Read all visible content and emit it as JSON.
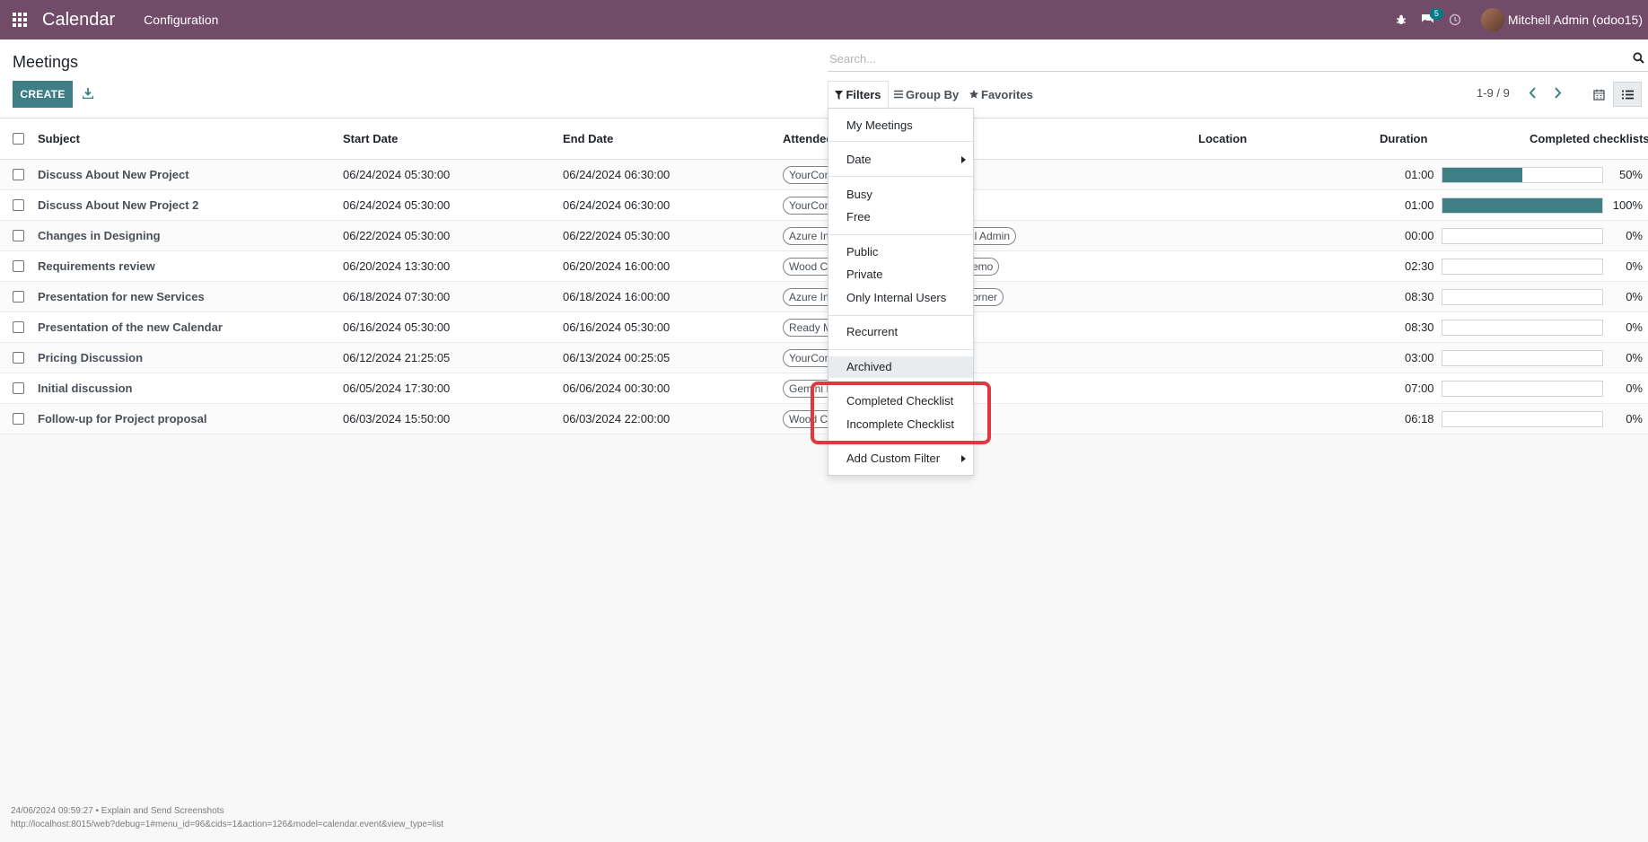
{
  "navbar": {
    "app_title": "Calendar",
    "menu_configuration": "Configuration",
    "messages_count": "5",
    "user_name": "Mitchell Admin (odoo15)"
  },
  "control_panel": {
    "page_title": "Meetings",
    "create_label": "CREATE",
    "search_placeholder": "Search...",
    "filters_label": "Filters",
    "group_by_label": "Group By",
    "favorites_label": "Favorites",
    "pager_value": "1-9 / 9"
  },
  "table": {
    "headers": {
      "subject": "Subject",
      "start_date": "Start Date",
      "end_date": "End Date",
      "attendees": "Attendee",
      "location": "Location",
      "duration": "Duration",
      "completed_checklists": "Completed checklists"
    },
    "rows": [
      {
        "subject": "Discuss About New Project",
        "start": "06/24/2024 05:30:00",
        "end": "06/24/2024 06:30:00",
        "tag1": "YourCom",
        "tag2": "",
        "duration": "01:00",
        "progress": 50,
        "progress_label": "50%"
      },
      {
        "subject": "Discuss About New Project 2",
        "start": "06/24/2024 05:30:00",
        "end": "06/24/2024 06:30:00",
        "tag1": "YourCom",
        "tag2": "",
        "duration": "01:00",
        "progress": 100,
        "progress_label": "100%"
      },
      {
        "subject": "Changes in Designing",
        "start": "06/22/2024 05:30:00",
        "end": "06/22/2024 05:30:00",
        "tag1": "Azure In",
        "tag2": "ll Admin",
        "duration": "00:00",
        "progress": 0,
        "progress_label": "0%"
      },
      {
        "subject": "Requirements review",
        "start": "06/20/2024 13:30:00",
        "end": "06/20/2024 16:00:00",
        "tag1": "Wood Co",
        "tag2": "emo",
        "duration": "02:30",
        "progress": 0,
        "progress_label": "0%"
      },
      {
        "subject": "Presentation for new Services",
        "start": "06/18/2024 07:30:00",
        "end": "06/18/2024 16:00:00",
        "tag1": "Azure In",
        "tag2": "orner",
        "duration": "08:30",
        "progress": 0,
        "progress_label": "0%"
      },
      {
        "subject": "Presentation of the new Calendar",
        "start": "06/16/2024 05:30:00",
        "end": "06/16/2024 05:30:00",
        "tag1": "Ready M",
        "tag2": "",
        "duration": "08:30",
        "progress": 0,
        "progress_label": "0%"
      },
      {
        "subject": "Pricing Discussion",
        "start": "06/12/2024 21:25:05",
        "end": "06/13/2024 00:25:05",
        "tag1": "YourCom",
        "tag2": "",
        "duration": "03:00",
        "progress": 0,
        "progress_label": "0%"
      },
      {
        "subject": "Initial discussion",
        "start": "06/05/2024 17:30:00",
        "end": "06/06/2024 00:30:00",
        "tag1": "Gemini I",
        "tag2": "",
        "duration": "07:00",
        "progress": 0,
        "progress_label": "0%"
      },
      {
        "subject": "Follow-up for Project proposal",
        "start": "06/03/2024 15:50:00",
        "end": "06/03/2024 22:00:00",
        "tag1": "Wood Co",
        "tag2": "",
        "duration": "06:18",
        "progress": 0,
        "progress_label": "0%"
      }
    ]
  },
  "filters_dropdown": {
    "my_meetings": "My Meetings",
    "date": "Date",
    "busy": "Busy",
    "free": "Free",
    "public": "Public",
    "private": "Private",
    "only_internal_users": "Only Internal Users",
    "recurrent": "Recurrent",
    "archived": "Archived",
    "completed_checklist": "Completed Checklist",
    "incomplete_checklist": "Incomplete Checklist",
    "add_custom_filter": "Add Custom Filter"
  },
  "footer": {
    "line1": "24/06/2024 09:59:27 • Explain and Send Screenshots",
    "line2": "http://localhost:8015/web?debug=1#menu_id=96&cids=1&action=126&model=calendar.event&view_type=list"
  },
  "colors": {
    "navbar": "#714b67",
    "primary": "#3e7f86",
    "highlight": "#e0383e"
  }
}
